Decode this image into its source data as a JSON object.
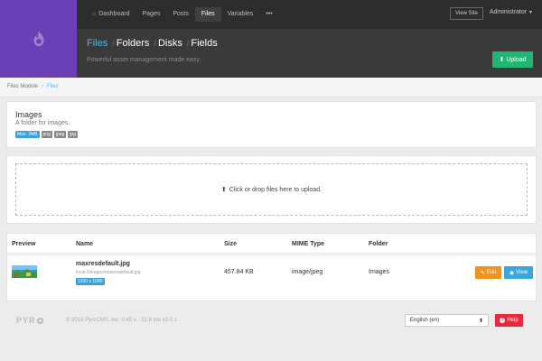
{
  "nav": {
    "items": [
      {
        "label": "Dashboard",
        "icon": "home-icon"
      },
      {
        "label": "Pages"
      },
      {
        "label": "Posts"
      },
      {
        "label": "Files",
        "active": true
      },
      {
        "label": "Variables"
      },
      {
        "label": "•••"
      }
    ],
    "view_site": "View Site",
    "user": "Administrator",
    "caret": "▼"
  },
  "section": {
    "crumbs": [
      {
        "label": "Files",
        "active": true
      },
      {
        "label": "Folders"
      },
      {
        "label": "Disks"
      },
      {
        "label": "Fields"
      }
    ],
    "separator": "/",
    "tagline": "Powerful asset management made easy.",
    "upload_label": "Upload",
    "upload_icon": "⬆"
  },
  "breadcrumb": {
    "parent": "Files Module",
    "chevron": "›",
    "current": "Files"
  },
  "folder": {
    "title": "Images",
    "description": "A folder for images.",
    "tags": [
      "Max: 2MB",
      "png",
      "jpeg",
      "jpg"
    ]
  },
  "dropzone": {
    "icon": "⬆",
    "text": "Click or drop files here to upload."
  },
  "table": {
    "headers": {
      "preview": "Preview",
      "name": "Name",
      "size": "Size",
      "mime": "MIME Type",
      "folder": "Folder"
    },
    "rows": [
      {
        "name": "maxresdefault.jpg",
        "path": "local://images/maxresdefault.jpg",
        "dimensions": "1920 x 1080",
        "size": "457.84 KB",
        "mime": "image/jpeg",
        "folder": "Images",
        "edit_label": "Edit",
        "edit_icon": "✎",
        "view_label": "View",
        "view_icon": "◉"
      }
    ]
  },
  "footer": {
    "logo": "PYR",
    "text": "© 2016 PyroCMS, Inc.  0.45 s · 21.8 mb  v3.0.1",
    "language": "English (en)",
    "select_caret": "⬍",
    "help": "Help",
    "help_icon": "?"
  },
  "colors": {
    "brand": "#6b3fb6",
    "accent": "#4db7e6",
    "upload": "#22b573",
    "edit": "#f0931f",
    "view": "#3aa6dc",
    "help": "#e8283c"
  }
}
